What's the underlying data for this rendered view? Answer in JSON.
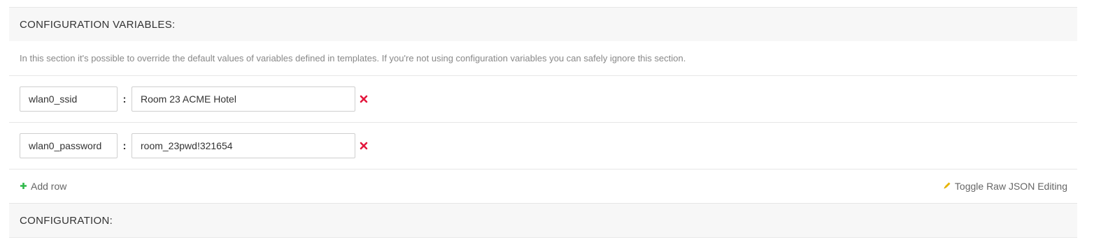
{
  "variables_section": {
    "title": "CONFIGURATION VARIABLES:",
    "help": "In this section it's possible to override the default values of variables defined in templates. If you're not using configuration variables you can safely ignore this section.",
    "rows": [
      {
        "key": "wlan0_ssid",
        "value": "Room 23 ACME Hotel"
      },
      {
        "key": "wlan0_password",
        "value": "room_23pwd!321654"
      }
    ],
    "separator": ":",
    "add_row_label": "Add row",
    "toggle_json_label": "Toggle Raw JSON Editing"
  },
  "configuration_section": {
    "title": "CONFIGURATION:"
  },
  "colors": {
    "remove": "#e3173d",
    "add": "#2fb84a",
    "pencil": "#e8b400"
  },
  "icons": {
    "remove": "close-icon",
    "add": "plus-icon",
    "toggle": "pencil-icon"
  }
}
